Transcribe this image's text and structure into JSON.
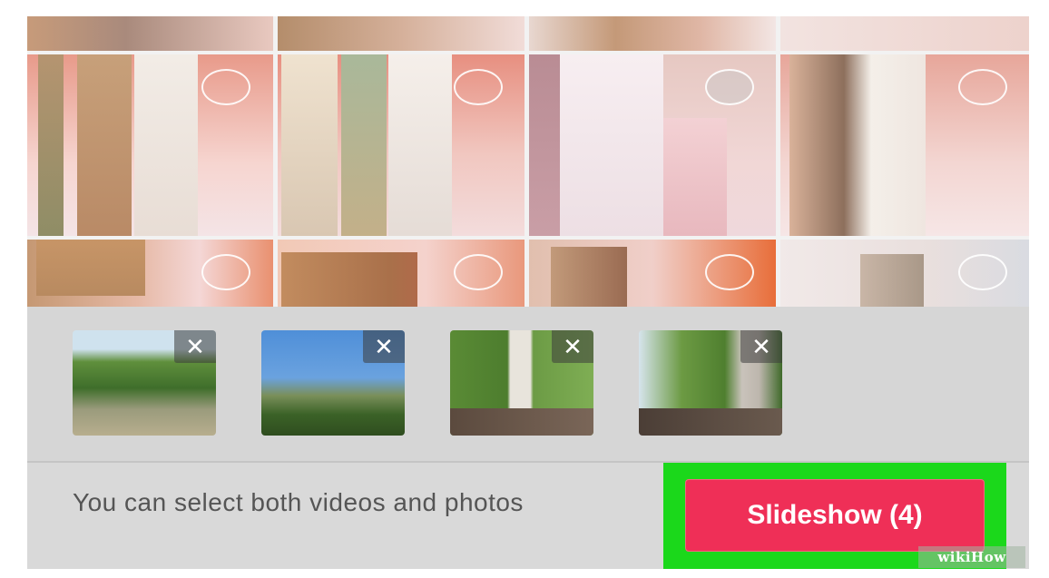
{
  "grid": {
    "tile_count_visible": 12
  },
  "tray": {
    "selected": [
      {
        "label": "selected-photo-1",
        "remove_glyph": "✕"
      },
      {
        "label": "selected-photo-2",
        "remove_glyph": "✕"
      },
      {
        "label": "selected-photo-3",
        "remove_glyph": "✕"
      },
      {
        "label": "selected-photo-4",
        "remove_glyph": "✕"
      }
    ]
  },
  "bottom": {
    "hint": "You can select both videos and photos",
    "slideshow_label": "Slideshow (4)"
  },
  "watermark": {
    "text": "wikiHow"
  },
  "colors": {
    "accent_button": "#ef2f57",
    "highlight_box": "#1bd81b",
    "tray_background": "#d6d6d6"
  },
  "icons": {
    "select_circle": "selection-circle-icon",
    "remove": "close-icon"
  }
}
